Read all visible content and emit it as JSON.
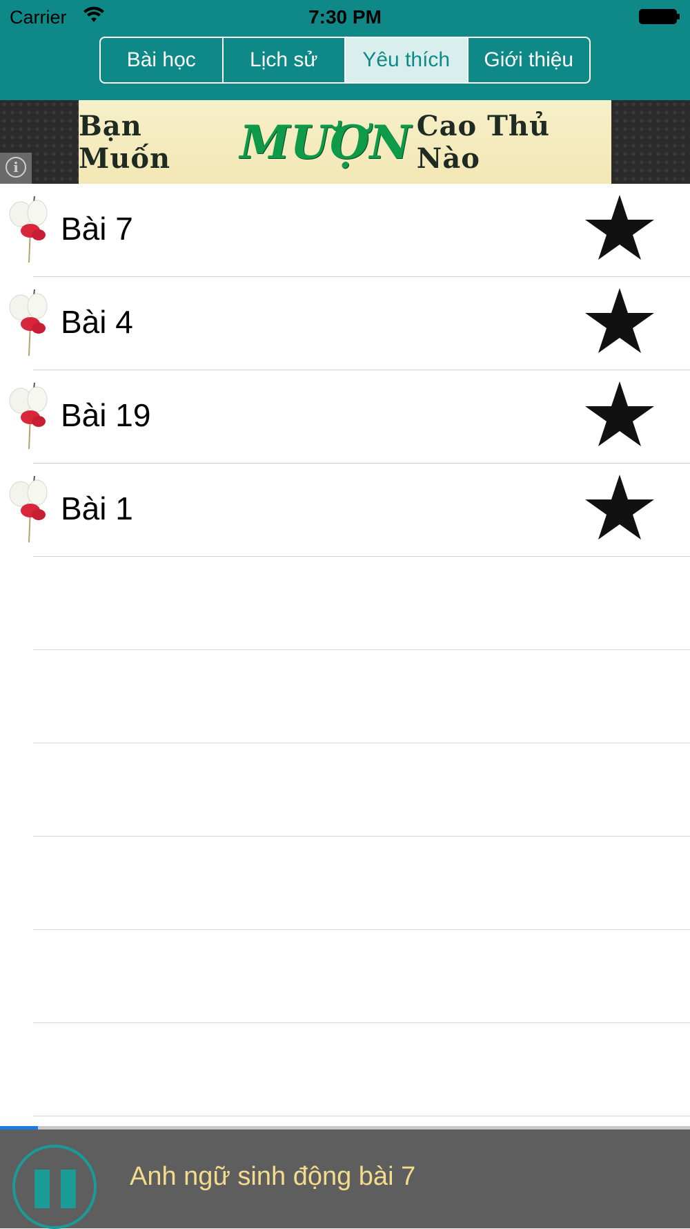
{
  "status_bar": {
    "carrier": "Carrier",
    "time": "7:30 PM"
  },
  "tabs": [
    {
      "label": "Bài học",
      "active": false
    },
    {
      "label": "Lịch sử",
      "active": false
    },
    {
      "label": "Yêu thích",
      "active": true
    },
    {
      "label": "Giới thiệu",
      "active": false
    }
  ],
  "ad": {
    "text_part1": "Bạn Muốn",
    "text_part2": "MƯỢN",
    "text_part3": "Cao Thủ Nào",
    "info_icon": "info-icon"
  },
  "favorites": [
    {
      "label": "Bài 7",
      "icon": "flower-icon",
      "starred": true
    },
    {
      "label": "Bài 4",
      "icon": "flower-icon",
      "starred": true
    },
    {
      "label": "Bài 19",
      "icon": "flower-icon",
      "starred": true
    },
    {
      "label": "Bài 1",
      "icon": "flower-icon",
      "starred": true
    }
  ],
  "player": {
    "now_playing": "Anh ngữ sinh động bài 7",
    "state_icon": "pause-icon",
    "progress": 0.055
  },
  "colors": {
    "header": "#0f8988",
    "accent": "#1a9b98",
    "player_bg": "#5e5e5e",
    "now_playing_text": "#f4dc8e",
    "progress": "#1a7be0"
  }
}
